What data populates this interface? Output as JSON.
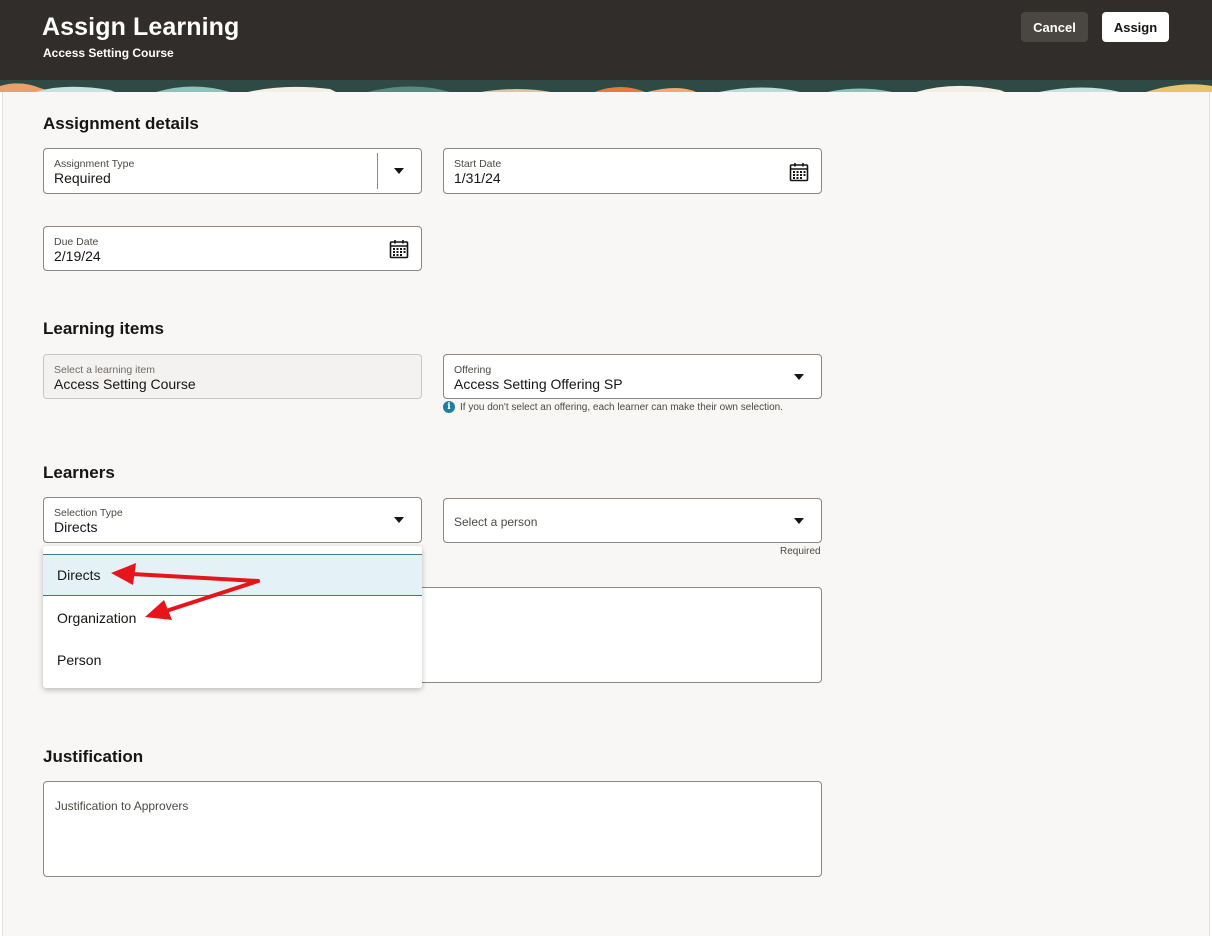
{
  "header": {
    "title": "Assign Learning",
    "subtitle": "Access Setting Course",
    "cancel_label": "Cancel",
    "assign_label": "Assign"
  },
  "assignment_details": {
    "section_title": "Assignment details",
    "assignment_type": {
      "label": "Assignment Type",
      "value": "Required"
    },
    "start_date": {
      "label": "Start Date",
      "value": "1/31/24"
    },
    "due_date": {
      "label": "Due Date",
      "value": "2/19/24"
    }
  },
  "learning_items": {
    "section_title": "Learning items",
    "learning_item": {
      "label": "Select a learning item",
      "value": "Access Setting Course"
    },
    "offering": {
      "label": "Offering",
      "value": "Access Setting Offering SP"
    },
    "hint": "If you don't select an offering, each learner can make their own selection."
  },
  "learners": {
    "section_title": "Learners",
    "selection_type": {
      "label": "Selection Type",
      "value": "Directs"
    },
    "person": {
      "placeholder": "Select a person",
      "required_text": "Required"
    },
    "dropdown_options": [
      "Directs",
      "Organization",
      "Person"
    ],
    "selected_option": "Directs"
  },
  "justification": {
    "section_title": "Justification",
    "placeholder": "Justification to Approvers"
  },
  "colors": {
    "header_bg": "#312d2a",
    "panel_bg": "#f8f7f5",
    "selected_option_bg": "#e4f1f7",
    "annotation_arrow": "#e8141c"
  }
}
